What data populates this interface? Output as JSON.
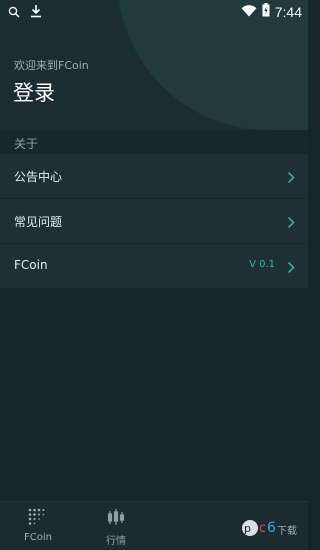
{
  "status_bar": {
    "time": "7:44",
    "icons": [
      "search-icon",
      "download-icon",
      "wifi-icon",
      "battery-icon"
    ]
  },
  "header": {
    "welcome_text": "欢迎来到FCoin",
    "login_label": "登录"
  },
  "section": {
    "label": "关于"
  },
  "menu": {
    "items": [
      {
        "label": "公告中心",
        "icon": "chevron-right-icon"
      },
      {
        "label": "常见问题",
        "icon": "chevron-right-icon"
      },
      {
        "label": "FCoin",
        "version": "V 0.1",
        "icon": "chevron-right-icon"
      }
    ]
  },
  "tabbar": {
    "tabs": [
      {
        "label": "FCoin",
        "icon": "fcoin-dots-icon",
        "active": true
      },
      {
        "label": "行情",
        "icon": "candlestick-icon",
        "active": false
      }
    ]
  },
  "colors": {
    "background": "#16252b",
    "header": "#1a2d33",
    "menu": "#1e2f36",
    "accent": "#2fbfa0",
    "text_primary": "#e6eef0",
    "text_secondary": "#8da1a6"
  }
}
